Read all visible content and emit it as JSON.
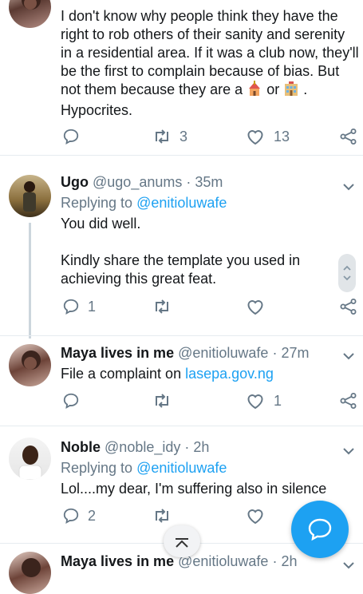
{
  "tweet1": {
    "lines": [
      "I don't know why people think they have the",
      "right to rob others of their sanity and serenity",
      "in a residential area. If it was a club now, they'll",
      "be the first to complain because of bias. But",
      "not them because they are a",
      "or",
      ".",
      "Hypocrites."
    ],
    "emoji_1": "church",
    "emoji_2": "mosque-building",
    "retweets": "3",
    "likes": "13"
  },
  "tweet2": {
    "name": "Ugo",
    "handle": "@ugo_anums",
    "sep": "·",
    "time": "35m",
    "replying_prefix": "Replying to",
    "replying_handle": "@enitioluwafe",
    "line1": "You did well.",
    "line2": "Kindly share the template you used in",
    "line3": "achieving this great feat.",
    "replies": "1"
  },
  "tweet3": {
    "name": "Maya lives in me",
    "handle": "@enitioluwafe",
    "sep": "·",
    "time": "27m",
    "text_prefix": "File a complaint on",
    "link": "lasepa.gov.ng",
    "likes": "1"
  },
  "tweet4": {
    "name": "Noble",
    "handle": "@noble_idy",
    "sep": "·",
    "time": "2h",
    "replying_prefix": "Replying to",
    "replying_handle": "@enitioluwafe",
    "text": "Lol....my dear, I'm suffering also in silence",
    "replies": "2"
  },
  "tweet5": {
    "name": "Maya lives in me",
    "handle": "@enitioluwafe",
    "sep": "·",
    "time": "2h"
  },
  "colors": {
    "accent": "#1da1f2",
    "muted": "#657786",
    "text": "#14171a",
    "divider": "#e6ecf0"
  },
  "icons": {
    "reply": "reply-icon",
    "retweet": "retweet-icon",
    "like": "heart-icon",
    "share": "share-icon",
    "more": "chevron-down-icon",
    "compose": "compose-reply-icon",
    "scroll_top": "scroll-to-top-icon"
  }
}
